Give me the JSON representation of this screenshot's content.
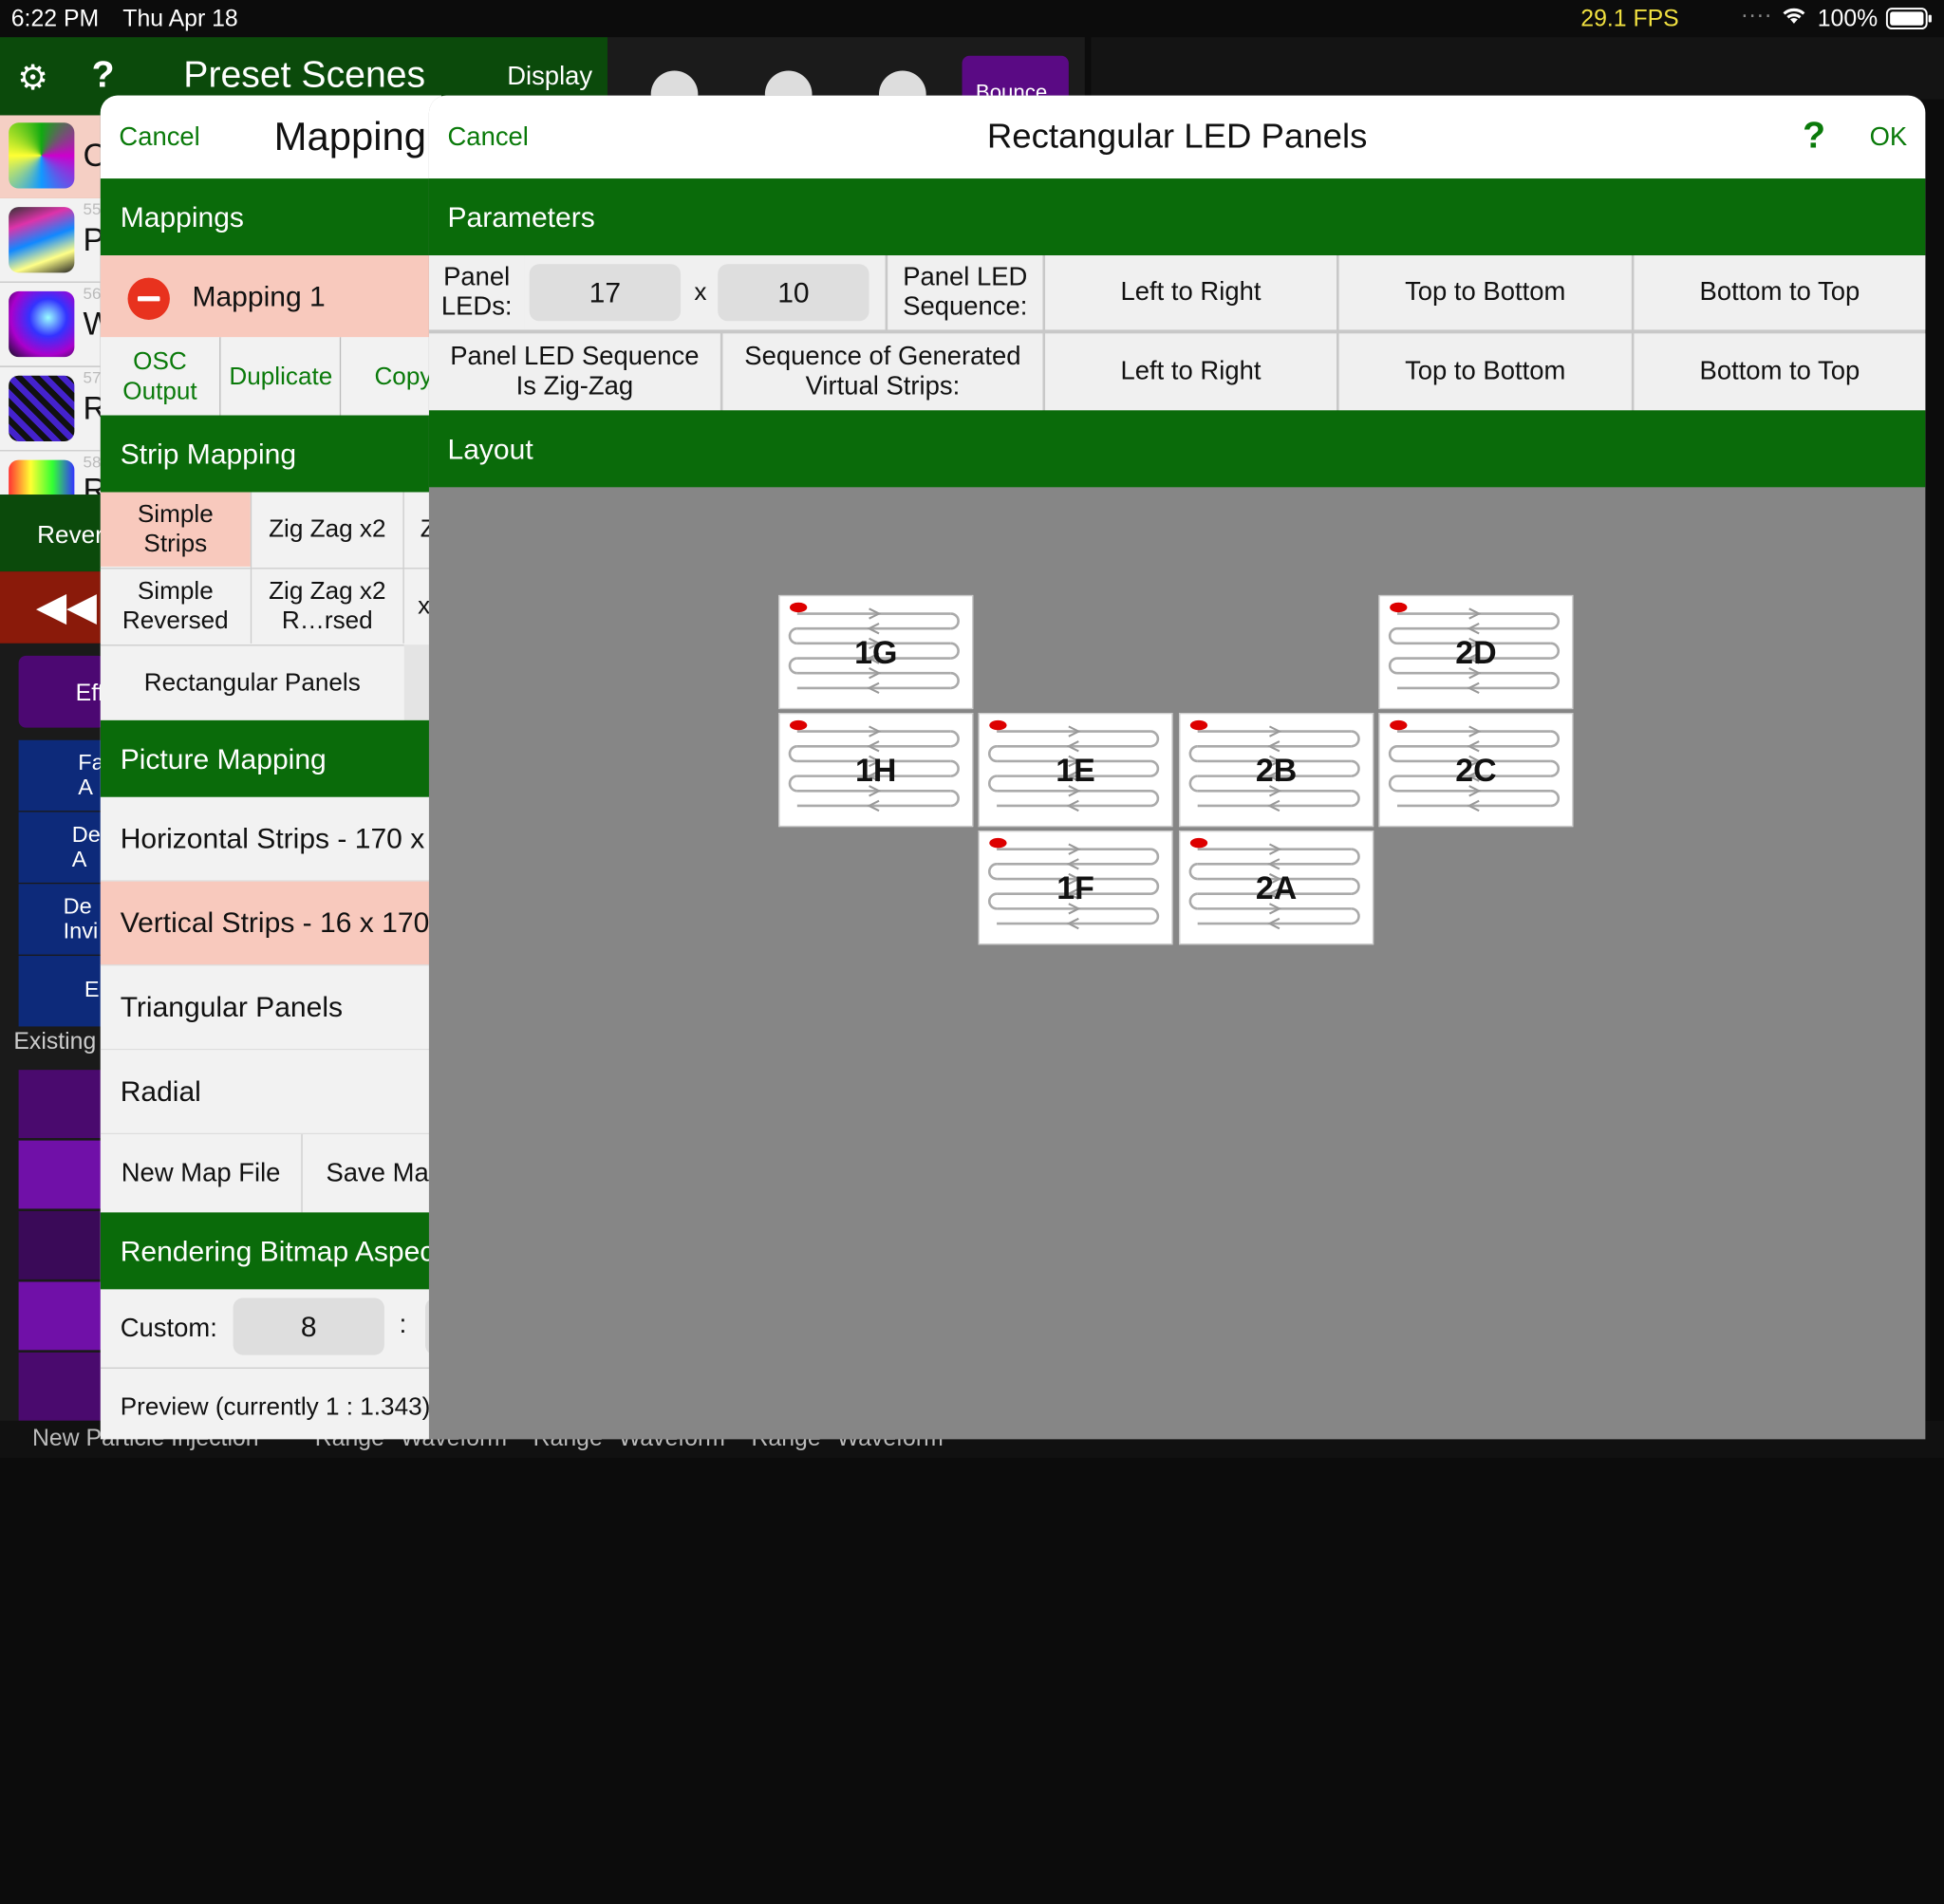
{
  "status": {
    "time": "6:22 PM",
    "date": "Thu Apr 18",
    "fps": "29.1 FPS",
    "battery": "100%"
  },
  "background": {
    "title": "Preset Scenes",
    "display": "Display",
    "bounce": "Bounce",
    "reverse": "Rever",
    "effects": "Eff",
    "existing": "Existing",
    "scene_numbers": [
      "55",
      "56",
      "57",
      "58"
    ],
    "scene_letters": [
      "C",
      "P",
      "W",
      "R",
      "R"
    ],
    "side_buttons": [
      "Fa A",
      "De A",
      "De Invi",
      "E"
    ],
    "bottom_tabs": [
      "New Particle Injection",
      "Range",
      "Waveform",
      "Range",
      "Waveform",
      "Range",
      "Waveform"
    ]
  },
  "left": {
    "cancel": "Cancel",
    "title": "Mapping",
    "mappings_header": "Mappings",
    "mapping_item": "Mapping 1",
    "actions": [
      "OSC Output",
      "Duplicate",
      "Copy"
    ],
    "strip_header": "Strip Mapping",
    "strip_options": [
      "Simple Strips",
      "Zig Zag x2",
      "Z",
      "Simple Reversed",
      "Zig Zag x2 R…rsed",
      "x"
    ],
    "rect_panels": "Rectangular Panels",
    "picture_header": "Picture Mapping",
    "picture_items": [
      "Horizontal Strips - 170 x",
      "Vertical Strips - 16 x 170",
      "Triangular Panels",
      "Radial"
    ],
    "map_buttons": [
      "New Map File",
      "Save Map"
    ],
    "render_header": "Rendering Bitmap Aspect",
    "custom_label": "Custom:",
    "custom_value": "8",
    "colon": ":",
    "preview": "Preview (currently 1 : 1.343)"
  },
  "right": {
    "cancel": "Cancel",
    "title": "Rectangular LED Panels",
    "help": "?",
    "ok": "OK",
    "parameters_header": "Parameters",
    "panel_leds_label": "Panel LEDs:",
    "led_w": "17",
    "x_sep": "x",
    "led_h": "10",
    "sequence_label": "Panel LED Sequence:",
    "sequence_options": [
      "Left to Right",
      "Top to Bottom",
      "Bottom to Top"
    ],
    "zigzag_label": "Panel LED Sequence Is Zig-Zag",
    "virtual_label": "Sequence of Generated Virtual Strips:",
    "virtual_options": [
      "Left to Right",
      "Top to Bottom",
      "Bottom to Top"
    ],
    "layout_header": "Layout",
    "panels": [
      "1G",
      "2D",
      "1H",
      "1E",
      "2B",
      "2C",
      "1F",
      "2A"
    ]
  },
  "colors": {
    "green": "#0a6b0a",
    "selected": "#f8c9bd",
    "layout_bg": "#868686",
    "purple": "#5a0a84"
  }
}
